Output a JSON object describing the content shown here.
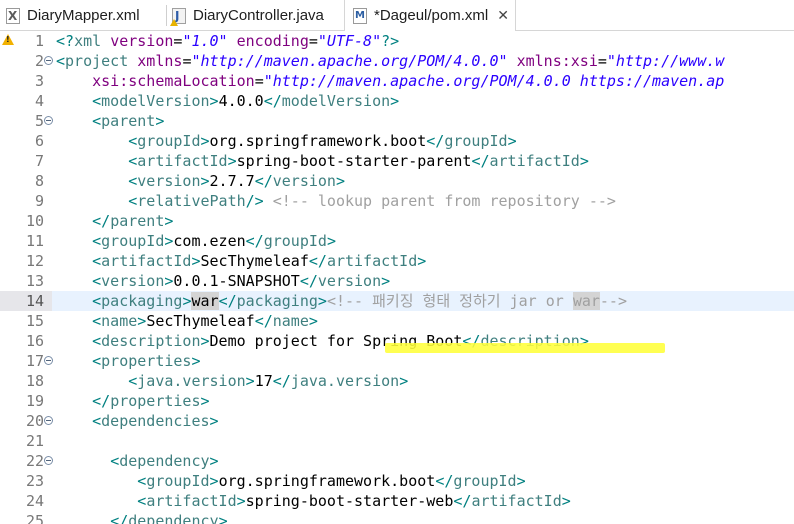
{
  "tabs": [
    {
      "label": "DiaryMapper.xml",
      "icon": "xml-file-icon"
    },
    {
      "label": "DiaryController.java",
      "icon": "java-file-icon"
    },
    {
      "label": "*Dageul/pom.xml",
      "icon": "pom-file-icon",
      "active": true
    }
  ],
  "gutter": {
    "warning_icon": "warning-icon",
    "current_line": 14
  },
  "lines": [
    {
      "n": "1",
      "fold": false,
      "tokens": [
        {
          "c": "p",
          "t": "<?"
        },
        {
          "c": "tn",
          "t": "xml"
        },
        {
          "c": "tx",
          "t": " "
        },
        {
          "c": "an",
          "t": "version"
        },
        {
          "c": "tx",
          "t": "="
        },
        {
          "c": "av",
          "t": "\"1.0\""
        },
        {
          "c": "tx",
          "t": " "
        },
        {
          "c": "an",
          "t": "encoding"
        },
        {
          "c": "tx",
          "t": "="
        },
        {
          "c": "av",
          "t": "\"UTF-8\""
        },
        {
          "c": "p",
          "t": "?>"
        }
      ]
    },
    {
      "n": "2",
      "fold": true,
      "tokens": [
        {
          "c": "p",
          "t": "<"
        },
        {
          "c": "tn",
          "t": "project"
        },
        {
          "c": "tx",
          "t": " "
        },
        {
          "c": "an",
          "t": "xmlns"
        },
        {
          "c": "tx",
          "t": "="
        },
        {
          "c": "av",
          "t": "\"http://maven.apache.org/POM/4.0.0\""
        },
        {
          "c": "tx",
          "t": " "
        },
        {
          "c": "an",
          "t": "xmlns:xsi"
        },
        {
          "c": "tx",
          "t": "="
        },
        {
          "c": "av",
          "t": "\"http://www.w"
        }
      ]
    },
    {
      "n": "3",
      "fold": false,
      "tokens": [
        {
          "c": "tx",
          "t": "    "
        },
        {
          "c": "an",
          "t": "xsi:schemaLocation"
        },
        {
          "c": "tx",
          "t": "="
        },
        {
          "c": "av",
          "t": "\"http://maven.apache.org/POM/4.0.0 https://maven.ap"
        }
      ]
    },
    {
      "n": "4",
      "fold": false,
      "tokens": [
        {
          "c": "tx",
          "t": "    "
        },
        {
          "c": "p",
          "t": "<"
        },
        {
          "c": "tn",
          "t": "modelVersion"
        },
        {
          "c": "p",
          "t": ">"
        },
        {
          "c": "tx",
          "t": "4.0.0"
        },
        {
          "c": "p",
          "t": "</"
        },
        {
          "c": "tn",
          "t": "modelVersion"
        },
        {
          "c": "p",
          "t": ">"
        }
      ]
    },
    {
      "n": "5",
      "fold": true,
      "tokens": [
        {
          "c": "tx",
          "t": "    "
        },
        {
          "c": "p",
          "t": "<"
        },
        {
          "c": "tn",
          "t": "parent"
        },
        {
          "c": "p",
          "t": ">"
        }
      ]
    },
    {
      "n": "6",
      "fold": false,
      "tokens": [
        {
          "c": "tx",
          "t": "        "
        },
        {
          "c": "p",
          "t": "<"
        },
        {
          "c": "tn",
          "t": "groupId"
        },
        {
          "c": "p",
          "t": ">"
        },
        {
          "c": "tx",
          "t": "org.springframework.boot"
        },
        {
          "c": "p",
          "t": "</"
        },
        {
          "c": "tn",
          "t": "groupId"
        },
        {
          "c": "p",
          "t": ">"
        }
      ]
    },
    {
      "n": "7",
      "fold": false,
      "tokens": [
        {
          "c": "tx",
          "t": "        "
        },
        {
          "c": "p",
          "t": "<"
        },
        {
          "c": "tn",
          "t": "artifactId"
        },
        {
          "c": "p",
          "t": ">"
        },
        {
          "c": "tx",
          "t": "spring-boot-starter-parent"
        },
        {
          "c": "p",
          "t": "</"
        },
        {
          "c": "tn",
          "t": "artifactId"
        },
        {
          "c": "p",
          "t": ">"
        }
      ]
    },
    {
      "n": "8",
      "fold": false,
      "tokens": [
        {
          "c": "tx",
          "t": "        "
        },
        {
          "c": "p",
          "t": "<"
        },
        {
          "c": "tn",
          "t": "version"
        },
        {
          "c": "p",
          "t": ">"
        },
        {
          "c": "tx",
          "t": "2.7.7"
        },
        {
          "c": "p",
          "t": "</"
        },
        {
          "c": "tn",
          "t": "version"
        },
        {
          "c": "p",
          "t": ">"
        }
      ]
    },
    {
      "n": "9",
      "fold": false,
      "tokens": [
        {
          "c": "tx",
          "t": "        "
        },
        {
          "c": "p",
          "t": "<"
        },
        {
          "c": "tn",
          "t": "relativePath"
        },
        {
          "c": "p",
          "t": "/>"
        },
        {
          "c": "tx",
          "t": " "
        },
        {
          "c": "cm",
          "t": "<!-- lookup parent from repository -->"
        }
      ]
    },
    {
      "n": "10",
      "fold": false,
      "tokens": [
        {
          "c": "tx",
          "t": "    "
        },
        {
          "c": "p",
          "t": "</"
        },
        {
          "c": "tn",
          "t": "parent"
        },
        {
          "c": "p",
          "t": ">"
        }
      ]
    },
    {
      "n": "11",
      "fold": false,
      "tokens": [
        {
          "c": "tx",
          "t": "    "
        },
        {
          "c": "p",
          "t": "<"
        },
        {
          "c": "tn",
          "t": "groupId"
        },
        {
          "c": "p",
          "t": ">"
        },
        {
          "c": "tx",
          "t": "com.ezen"
        },
        {
          "c": "p",
          "t": "</"
        },
        {
          "c": "tn",
          "t": "groupId"
        },
        {
          "c": "p",
          "t": ">"
        }
      ]
    },
    {
      "n": "12",
      "fold": false,
      "tokens": [
        {
          "c": "tx",
          "t": "    "
        },
        {
          "c": "p",
          "t": "<"
        },
        {
          "c": "tn",
          "t": "artifactId"
        },
        {
          "c": "p",
          "t": ">"
        },
        {
          "c": "tx",
          "t": "SecThymeleaf"
        },
        {
          "c": "p",
          "t": "</"
        },
        {
          "c": "tn",
          "t": "artifactId"
        },
        {
          "c": "p",
          "t": ">"
        }
      ]
    },
    {
      "n": "13",
      "fold": false,
      "tokens": [
        {
          "c": "tx",
          "t": "    "
        },
        {
          "c": "p",
          "t": "<"
        },
        {
          "c": "tn",
          "t": "version"
        },
        {
          "c": "p",
          "t": ">"
        },
        {
          "c": "tx",
          "t": "0.0.1-SNAPSHOT"
        },
        {
          "c": "p",
          "t": "</"
        },
        {
          "c": "tn",
          "t": "version"
        },
        {
          "c": "p",
          "t": ">"
        }
      ]
    },
    {
      "n": "14",
      "fold": false,
      "current": true,
      "tokens": [
        {
          "c": "tx",
          "t": "    "
        },
        {
          "c": "p",
          "t": "<"
        },
        {
          "c": "tn",
          "t": "packaging"
        },
        {
          "c": "p",
          "t": ">"
        },
        {
          "c": "tx hl",
          "t": "war"
        },
        {
          "c": "p",
          "t": "</"
        },
        {
          "c": "tn",
          "t": "packaging"
        },
        {
          "c": "p",
          "t": ">"
        },
        {
          "c": "cm",
          "t": "<!-- 패키징 형태 정하기 jar or "
        },
        {
          "c": "cm hl2",
          "t": "war"
        },
        {
          "c": "cm",
          "t": "-->"
        }
      ]
    },
    {
      "n": "15",
      "fold": false,
      "tokens": [
        {
          "c": "tx",
          "t": "    "
        },
        {
          "c": "p",
          "t": "<"
        },
        {
          "c": "tn",
          "t": "name"
        },
        {
          "c": "p",
          "t": ">"
        },
        {
          "c": "tx",
          "t": "SecThymeleaf"
        },
        {
          "c": "p",
          "t": "</"
        },
        {
          "c": "tn",
          "t": "name"
        },
        {
          "c": "p",
          "t": ">"
        }
      ]
    },
    {
      "n": "16",
      "fold": false,
      "tokens": [
        {
          "c": "tx",
          "t": "    "
        },
        {
          "c": "p",
          "t": "<"
        },
        {
          "c": "tn",
          "t": "description"
        },
        {
          "c": "p",
          "t": ">"
        },
        {
          "c": "tx",
          "t": "Demo project for Spring Boot"
        },
        {
          "c": "p",
          "t": "</"
        },
        {
          "c": "tn",
          "t": "description"
        },
        {
          "c": "p",
          "t": ">"
        }
      ]
    },
    {
      "n": "17",
      "fold": true,
      "tokens": [
        {
          "c": "tx",
          "t": "    "
        },
        {
          "c": "p",
          "t": "<"
        },
        {
          "c": "tn",
          "t": "properties"
        },
        {
          "c": "p",
          "t": ">"
        }
      ]
    },
    {
      "n": "18",
      "fold": false,
      "tokens": [
        {
          "c": "tx",
          "t": "        "
        },
        {
          "c": "p",
          "t": "<"
        },
        {
          "c": "tn",
          "t": "java.version"
        },
        {
          "c": "p",
          "t": ">"
        },
        {
          "c": "tx",
          "t": "17"
        },
        {
          "c": "p",
          "t": "</"
        },
        {
          "c": "tn",
          "t": "java.version"
        },
        {
          "c": "p",
          "t": ">"
        }
      ]
    },
    {
      "n": "19",
      "fold": false,
      "tokens": [
        {
          "c": "tx",
          "t": "    "
        },
        {
          "c": "p",
          "t": "</"
        },
        {
          "c": "tn",
          "t": "properties"
        },
        {
          "c": "p",
          "t": ">"
        }
      ]
    },
    {
      "n": "20",
      "fold": true,
      "tokens": [
        {
          "c": "tx",
          "t": "    "
        },
        {
          "c": "p",
          "t": "<"
        },
        {
          "c": "tn",
          "t": "dependencies"
        },
        {
          "c": "p",
          "t": ">"
        }
      ]
    },
    {
      "n": "21",
      "fold": false,
      "tokens": []
    },
    {
      "n": "22",
      "fold": true,
      "tokens": [
        {
          "c": "tx",
          "t": "      "
        },
        {
          "c": "p",
          "t": "<"
        },
        {
          "c": "tn",
          "t": "dependency"
        },
        {
          "c": "p",
          "t": ">"
        }
      ]
    },
    {
      "n": "23",
      "fold": false,
      "tokens": [
        {
          "c": "tx",
          "t": "         "
        },
        {
          "c": "p",
          "t": "<"
        },
        {
          "c": "tn",
          "t": "groupId"
        },
        {
          "c": "p",
          "t": ">"
        },
        {
          "c": "tx",
          "t": "org.springframework.boot"
        },
        {
          "c": "p",
          "t": "</"
        },
        {
          "c": "tn",
          "t": "groupId"
        },
        {
          "c": "p",
          "t": ">"
        }
      ]
    },
    {
      "n": "24",
      "fold": false,
      "tokens": [
        {
          "c": "tx",
          "t": "         "
        },
        {
          "c": "p",
          "t": "<"
        },
        {
          "c": "tn",
          "t": "artifactId"
        },
        {
          "c": "p",
          "t": ">"
        },
        {
          "c": "tx",
          "t": "spring-boot-starter-web"
        },
        {
          "c": "p",
          "t": "</"
        },
        {
          "c": "tn",
          "t": "artifactId"
        },
        {
          "c": "p",
          "t": ">"
        }
      ]
    },
    {
      "n": "25",
      "fold": false,
      "tokens": [
        {
          "c": "tx",
          "t": "      "
        },
        {
          "c": "p",
          "t": "</"
        },
        {
          "c": "tn",
          "t": "dependency"
        },
        {
          "c": "p",
          "t": ">"
        }
      ]
    }
  ],
  "colors": {
    "tag_bracket": "#008080",
    "tag_name": "#3f7f7f",
    "attr_name": "#7f007f",
    "attr_value": "#2a00ff",
    "comment": "#a0a0a0",
    "current_line_bg": "#e8f2fe",
    "annotation_highlight": "#ffff3a"
  }
}
